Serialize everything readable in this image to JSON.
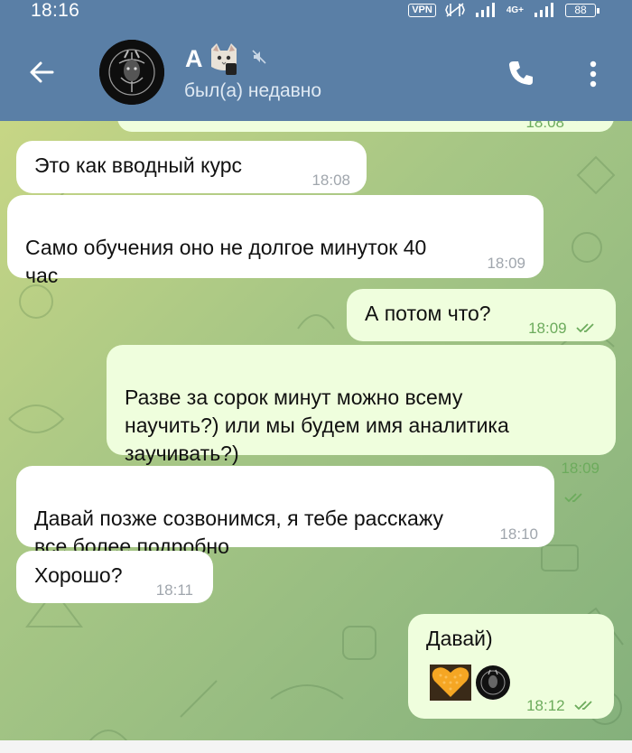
{
  "status_bar": {
    "time": "18:16",
    "vpn": "VPN",
    "network": "4G+",
    "battery": "88"
  },
  "header": {
    "chat_name": "А",
    "status": "был(а) недавно",
    "back_icon": "arrow-left-icon",
    "call_icon": "phone-icon",
    "menu_icon": "more-vertical-icon",
    "mute_icon": "muted-icon"
  },
  "messages": [
    {
      "direction": "out",
      "text": "",
      "time": "18:08"
    },
    {
      "direction": "in",
      "text": "Это как вводный курс",
      "time": "18:08"
    },
    {
      "direction": "in",
      "text": "Само обучения оно не долгое минуток 40\nчас",
      "time": "18:09"
    },
    {
      "direction": "out",
      "text": "А потом что?",
      "time": "18:09",
      "read": true
    },
    {
      "direction": "out",
      "text": "Разве за сорок минут можно всему\nнаучить?) или мы будем имя аналитика\nзаучивать?)",
      "time": "18:09",
      "read": true
    },
    {
      "direction": "in",
      "text": "Давай позже созвонимся, я тебе расскажу\nвсе более подробно",
      "time": "18:10"
    },
    {
      "direction": "in",
      "text": "Хорошо?",
      "time": "18:11"
    },
    {
      "direction": "out",
      "text": "Давай)",
      "time": "18:12",
      "read": true,
      "stickers": [
        "heart-emoji-icon",
        "avatar-sticker-icon"
      ]
    }
  ],
  "colors": {
    "header": "#5a7fa6",
    "bubble_in": "#ffffff",
    "bubble_out": "#effedd",
    "time_out": "#6cab5c"
  }
}
